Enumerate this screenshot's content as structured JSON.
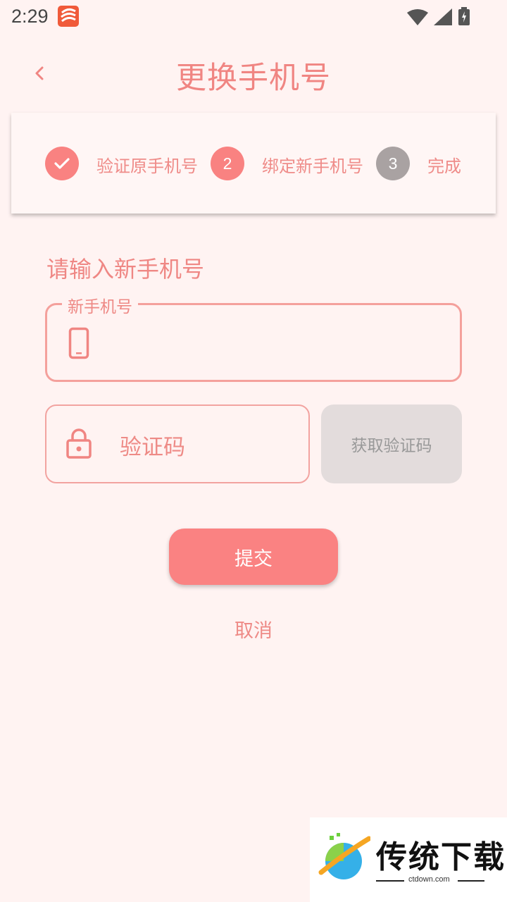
{
  "status_bar": {
    "time": "2:29"
  },
  "header": {
    "title": "更换手机号"
  },
  "steps": [
    {
      "label": "验证原手机号",
      "number": "",
      "state": "done",
      "color": "#f98281"
    },
    {
      "label": "绑定新手机号",
      "number": "2",
      "state": "active",
      "color": "#f98281"
    },
    {
      "label": "完成",
      "number": "3",
      "state": "pending",
      "color": "#a9a2a2"
    }
  ],
  "form": {
    "section_title": "请输入新手机号",
    "phone_label": "新手机号",
    "phone_value": "",
    "code_placeholder": "验证码",
    "get_code_label": "获取验证码"
  },
  "actions": {
    "submit_label": "提交",
    "cancel_label": "取消"
  },
  "watermark": {
    "text": "传统下载",
    "url": "ctdown.com"
  },
  "colors": {
    "accent": "#f98281",
    "background": "#fff3f2",
    "disabled": "#e3dcdc"
  }
}
